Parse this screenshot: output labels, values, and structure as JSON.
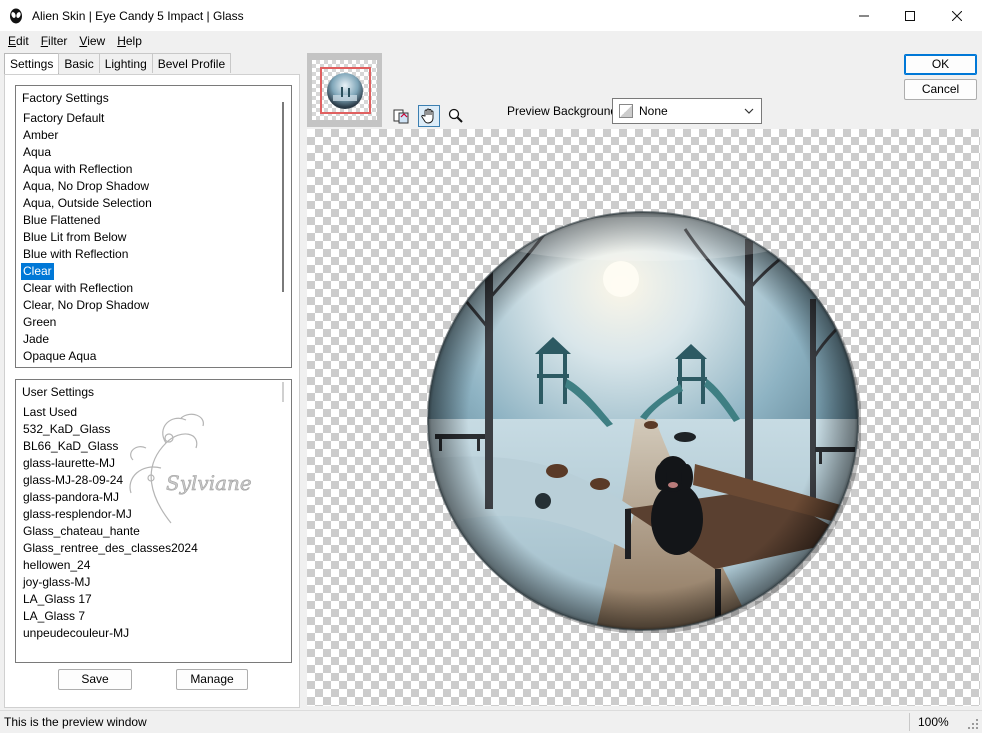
{
  "window": {
    "title": "Alien Skin | Eye Candy 5 Impact | Glass",
    "app_icon": "alien-skin-icon",
    "controls": [
      "minimize-icon",
      "maximize-icon",
      "close-icon"
    ]
  },
  "menu": {
    "edit": "Edit",
    "edit_key": "E",
    "edit_rest": "dit",
    "filter": "Filter",
    "filter_key": "F",
    "filter_rest": "ilter",
    "view": "View",
    "view_key": "V",
    "view_rest": "iew",
    "help": "Help",
    "help_key": "H",
    "help_rest": "elp"
  },
  "tabs": [
    "Settings",
    "Basic",
    "Lighting",
    "Bevel Profile"
  ],
  "active_tab": "Settings",
  "factory": {
    "header": "Factory Settings",
    "items": [
      "Factory Default",
      "Amber",
      "Aqua",
      "Aqua with Reflection",
      "Aqua, No Drop Shadow",
      "Aqua, Outside Selection",
      "Blue Flattened",
      "Blue Lit from Below",
      "Blue with Reflection",
      "Clear",
      "Clear with Reflection",
      "Clear, No Drop Shadow",
      "Green",
      "Jade",
      "Opaque Aqua"
    ],
    "selected": "Clear"
  },
  "user": {
    "header": "User Settings",
    "items": [
      "Last Used",
      "532_KaD_Glass",
      "BL66_KaD_Glass",
      "glass-laurette-MJ",
      "glass-MJ-28-09-24",
      "glass-pandora-MJ",
      "glass-resplendor-MJ",
      "Glass_chateau_hante",
      "Glass_rentree_des_classes2024",
      "hellowen_24",
      "joy-glass-MJ",
      "LA_Glass 17",
      "LA_Glass 7",
      "unpeudecouleur-MJ"
    ],
    "watermark_text": "Sylviane"
  },
  "buttons": {
    "save": "Save",
    "manage": "Manage",
    "ok": "OK",
    "cancel": "Cancel"
  },
  "toolbar": {
    "tools": [
      "preview-toggle-icon",
      "hand-tool-icon",
      "zoom-tool-icon"
    ],
    "active_tool": "hand-tool-icon"
  },
  "preview_background": {
    "label": "Preview Background:",
    "value": "None"
  },
  "status": {
    "message": "This is the preview window",
    "zoom": "100%"
  },
  "colors": {
    "selection": "#0078d7",
    "ok_border": "#0078d7",
    "checker": "#cccccc"
  }
}
